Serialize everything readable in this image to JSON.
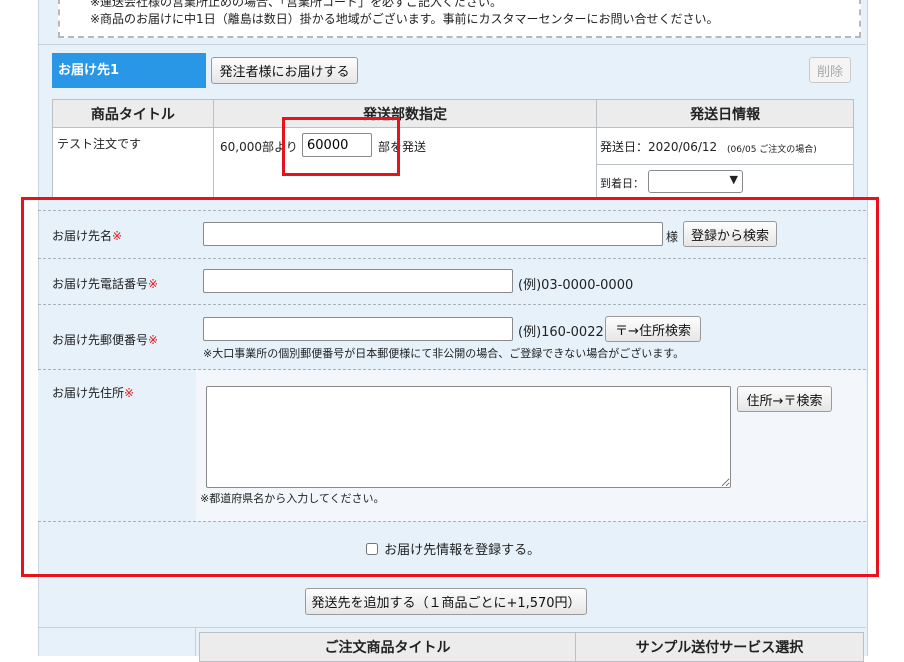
{
  "notice": {
    "line1": "※運送会社様の営業所止めの場合、「営業所コード」を必ずご記入ください。",
    "line2": "※商品のお届けに中1日（離島は数日）掛かる地域がございます。事前にカスタマーセンターにお問い合せください。"
  },
  "destination": {
    "tab_label": "お届け先1",
    "send_to_orderer_button": "発注者様にお届けする",
    "delete_button": "削除"
  },
  "order_table": {
    "headers": [
      "商品タイトル",
      "発送部数指定",
      "発送日情報"
    ],
    "title": "テスト注文です",
    "qty_prefix": "60,000部より",
    "qty_value": "60000",
    "qty_suffix": "部を発送",
    "ship_date": "発送日：2020/06/12",
    "ship_note": "(06/05 ご注文の場合)",
    "arrival_label": "到着日：",
    "arrival_selected": ""
  },
  "form": {
    "name_label": "お届け先名",
    "required_mark": "※",
    "name_suffix": "様",
    "search_registered_button": "登録から検索",
    "phone_label": "お届け先電話番号",
    "phone_example": "(例)03-0000-0000",
    "postal_label": "お届け先郵便番号",
    "postal_example": "(例)160-0022",
    "postal_search_button": "〒→住所検索",
    "postal_note": "※大口事業所の個別郵便番号が日本郵便様にて非公開の場合、ご登録できない場合がございます。",
    "address_label": "お届け先住所",
    "address_search_button": "住所→〒検索",
    "address_note": "※都道府県名から入力してください。",
    "register_checkbox_label": "お届け先情報を登録する。"
  },
  "add_destination_button": "発送先を追加する（１商品ごとに+1,570円）",
  "sample_table": {
    "headers": [
      "ご注文商品タイトル",
      "サンプル送付サービス選択"
    ]
  },
  "colors": {
    "tab_blue": "#2a97e6",
    "panel_bg": "#e7f1fa",
    "highlight_red": "#e8121c",
    "required_red": "#e31b1b"
  }
}
